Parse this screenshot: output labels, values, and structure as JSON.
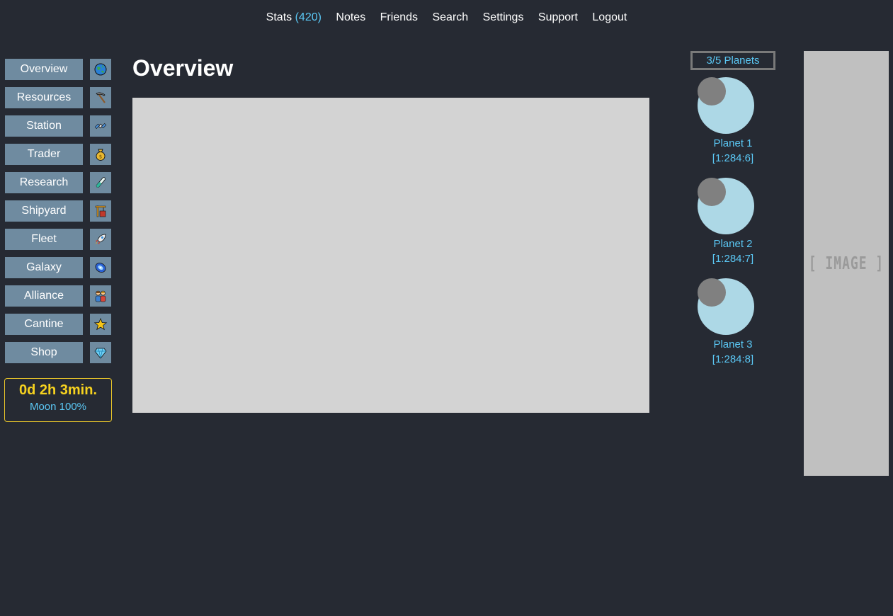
{
  "nav": {
    "stats_label": "Stats",
    "stats_count": "(420)",
    "notes": "Notes",
    "friends": "Friends",
    "search": "Search",
    "settings": "Settings",
    "support": "Support",
    "logout": "Logout"
  },
  "menu": [
    {
      "label": "Overview",
      "icon": "globe-icon"
    },
    {
      "label": "Resources",
      "icon": "pickaxe-icon"
    },
    {
      "label": "Station",
      "icon": "satellite-icon"
    },
    {
      "label": "Trader",
      "icon": "money-bag-icon"
    },
    {
      "label": "Research",
      "icon": "test-tube-icon"
    },
    {
      "label": "Shipyard",
      "icon": "construction-crane-icon"
    },
    {
      "label": "Fleet",
      "icon": "rocket-icon"
    },
    {
      "label": "Galaxy",
      "icon": "galaxy-icon"
    },
    {
      "label": "Alliance",
      "icon": "people-icon"
    },
    {
      "label": "Cantine",
      "icon": "star-icon"
    },
    {
      "label": "Shop",
      "icon": "gem-icon"
    }
  ],
  "timer": {
    "time": "0d 2h 3min.",
    "moon": "Moon 100%"
  },
  "page": {
    "title": "Overview"
  },
  "planets": {
    "count_label": "3/5 Planets",
    "items": [
      {
        "name": "Planet 1",
        "coords": "[1:284:6]"
      },
      {
        "name": "Planet 2",
        "coords": "[1:284:7]"
      },
      {
        "name": "Planet 3",
        "coords": "[1:284:8]"
      }
    ]
  },
  "ad": {
    "placeholder": "[ IMAGE ]"
  },
  "colors": {
    "background": "#262a33",
    "menu_button": "#6f8ba0",
    "accent_blue": "#5bc8f5",
    "timer_yellow": "#f6d21f",
    "planet": "#add8e6",
    "moon": "#808080"
  }
}
